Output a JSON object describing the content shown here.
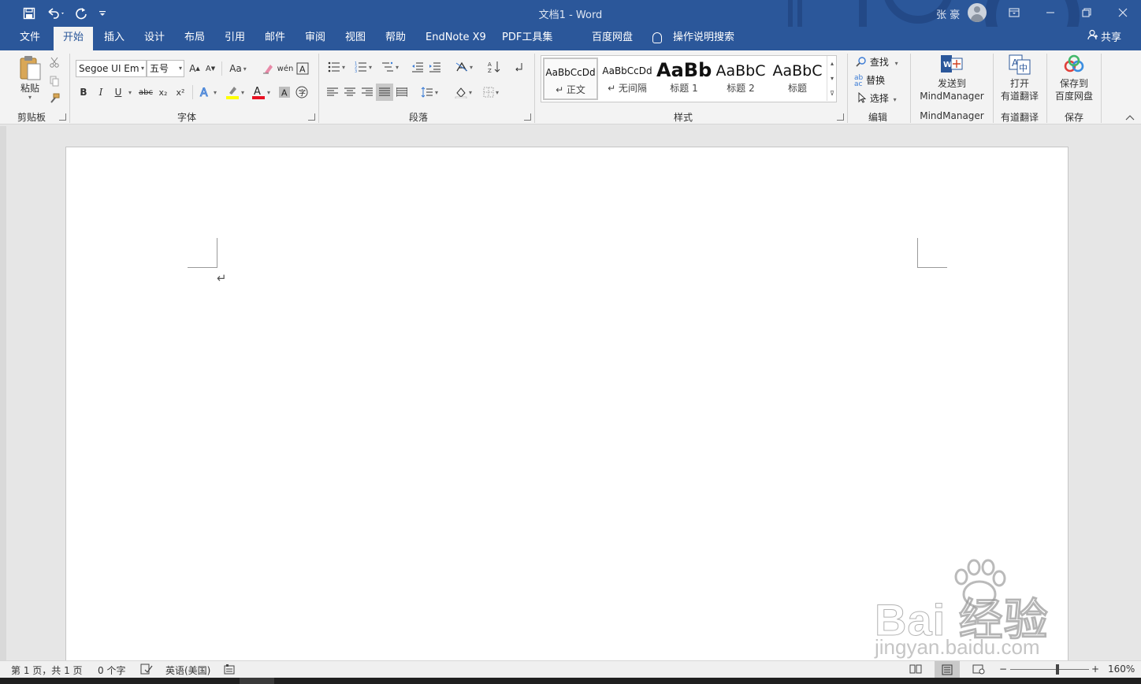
{
  "titlebar": {
    "doc_title": "文档1 - Word",
    "user_name": "张 豪",
    "quick_access": {
      "save_icon": "floppy-disk-icon",
      "undo_icon": "undo-icon",
      "redo_icon": "redo-icon",
      "customize_icon": "customize-quick-access-icon"
    },
    "window_icons": [
      "ribbon-display-options-icon",
      "minimize-icon",
      "restore-icon",
      "close-icon"
    ]
  },
  "tabs": [
    {
      "label": "文件"
    },
    {
      "label": "开始",
      "active": true
    },
    {
      "label": "插入"
    },
    {
      "label": "设计"
    },
    {
      "label": "布局"
    },
    {
      "label": "引用"
    },
    {
      "label": "邮件"
    },
    {
      "label": "审阅"
    },
    {
      "label": "视图"
    },
    {
      "label": "帮助"
    },
    {
      "label": "EndNote X9"
    },
    {
      "label": "PDF工具集"
    },
    {
      "label": "百度网盘"
    },
    {
      "label": "操作说明搜索"
    }
  ],
  "share_label": "共享",
  "ribbon": {
    "clipboard": {
      "paste_label": "粘贴",
      "group_label": "剪贴板"
    },
    "font": {
      "font_name": "Segoe UI Em",
      "font_size": "五号",
      "group_label": "字体",
      "change_case": "Aa",
      "bold": "B",
      "italic": "I",
      "underline": "U",
      "strikethrough": "abc",
      "subscript": "x₂",
      "superscript": "x²",
      "font_color_accent": "#e81123",
      "highlight_accent": "#ffff00"
    },
    "paragraph": {
      "group_label": "段落"
    },
    "styles": {
      "group_label": "样式",
      "items": [
        {
          "sample": "AaBbCcDd",
          "name": "↵ 正文"
        },
        {
          "sample": "AaBbCcDd",
          "name": "↵ 无间隔"
        },
        {
          "sample": "AaBb",
          "name": "标题 1"
        },
        {
          "sample": "AaBbC",
          "name": "标题 2"
        },
        {
          "sample": "AaBbC",
          "name": "标题"
        }
      ]
    },
    "editing": {
      "group_label": "编辑",
      "find": "查找",
      "replace": "替换",
      "select": "选择"
    },
    "mindmanager": {
      "line1": "发送到",
      "line2": "MindManager",
      "group_label": "MindManager"
    },
    "youdao": {
      "line1": "打开",
      "line2": "有道翻译",
      "group_label": "有道翻译"
    },
    "baidu": {
      "line1": "保存到",
      "line2": "百度网盘",
      "group_label": "保存"
    }
  },
  "document": {
    "paragraph_mark": "↵"
  },
  "statusbar": {
    "page_info": "第 1 页，共 1 页",
    "word_count": "0 个字",
    "language": "英语(美国)",
    "zoom_minus": "−",
    "zoom_plus": "+",
    "zoom_level": "160%",
    "zoom_fraction": 0.6
  },
  "watermark": {
    "brand": "Bai 经验",
    "url": "jingyan.baidu.com"
  }
}
